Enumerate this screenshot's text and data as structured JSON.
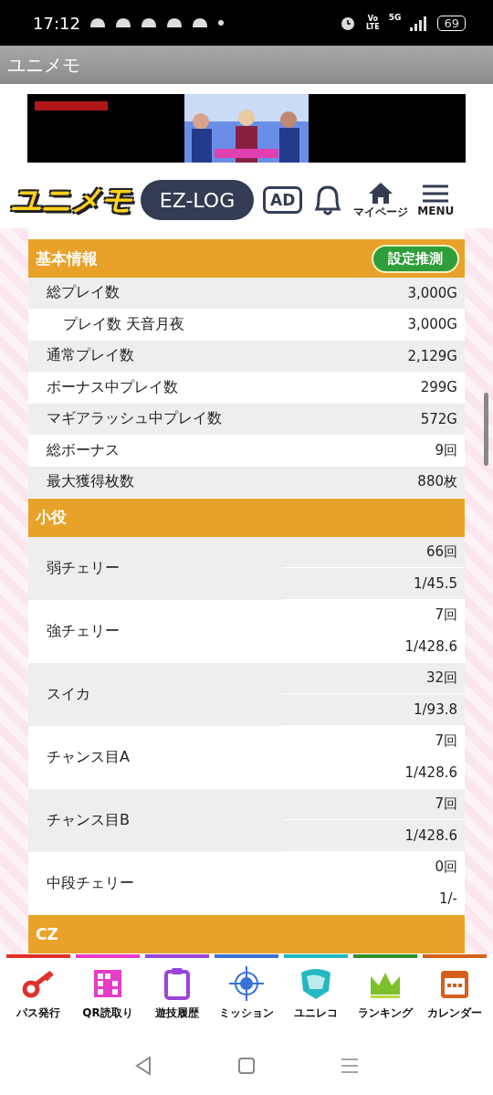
{
  "status_bar": {
    "time": "17:12",
    "volte": [
      "Vo",
      "LTE"
    ],
    "network": "5G",
    "battery": "69"
  },
  "app_bar": {
    "title": "ユニメモ"
  },
  "header": {
    "logo": "ユニメモ",
    "ezlog": "EZ-LOG",
    "ad_button": "AD",
    "mypage": "マイページ",
    "menu": "MENU"
  },
  "basic_info": {
    "title": "基本情報",
    "action": "設定推測",
    "rows": [
      {
        "label": "総プレイ数",
        "value": "3,000G",
        "children": [
          {
            "label": "プレイ数 天音月夜",
            "value": "3,000G"
          }
        ]
      },
      {
        "label": "通常プレイ数",
        "value": "2,129G"
      },
      {
        "label": "ボーナス中プレイ数",
        "value": "299G"
      },
      {
        "label": "マギアラッシュ中プレイ数",
        "value": "572G"
      },
      {
        "label": "総ボーナス",
        "value": "9回"
      },
      {
        "label": "最大獲得枚数",
        "value": "880枚"
      }
    ]
  },
  "small_roles": {
    "title": "小役",
    "rows": [
      {
        "label": "弱チェリー",
        "count": "66回",
        "rate": "1/45.5"
      },
      {
        "label": "強チェリー",
        "count": "7回",
        "rate": "1/428.6"
      },
      {
        "label": "スイカ",
        "count": "32回",
        "rate": "1/93.8"
      },
      {
        "label": "チャンス目A",
        "count": "7回",
        "rate": "1/428.6"
      },
      {
        "label": "チャンス目B",
        "count": "7回",
        "rate": "1/428.6"
      },
      {
        "label": "中段チェリー",
        "count": "0回",
        "rate": "1/-"
      }
    ]
  },
  "cz": {
    "title": "CZ"
  },
  "bottom_nav": [
    {
      "kind": "key",
      "label": "パス発行",
      "color": "#e0302a"
    },
    {
      "kind": "qr",
      "label": "QR読取り",
      "color": "#e63cc8"
    },
    {
      "kind": "clipboard",
      "label": "遊技履歴",
      "color": "#9b45d8"
    },
    {
      "kind": "target",
      "label": "ミッション",
      "color": "#3a72d8"
    },
    {
      "kind": "badge",
      "label": "ユニレコ",
      "color": "#25b8c0"
    },
    {
      "kind": "crown",
      "label": "ランキング",
      "color": "#2e8f2a"
    },
    {
      "kind": "calendar",
      "label": "カレンダー",
      "color": "#d4601a"
    }
  ]
}
